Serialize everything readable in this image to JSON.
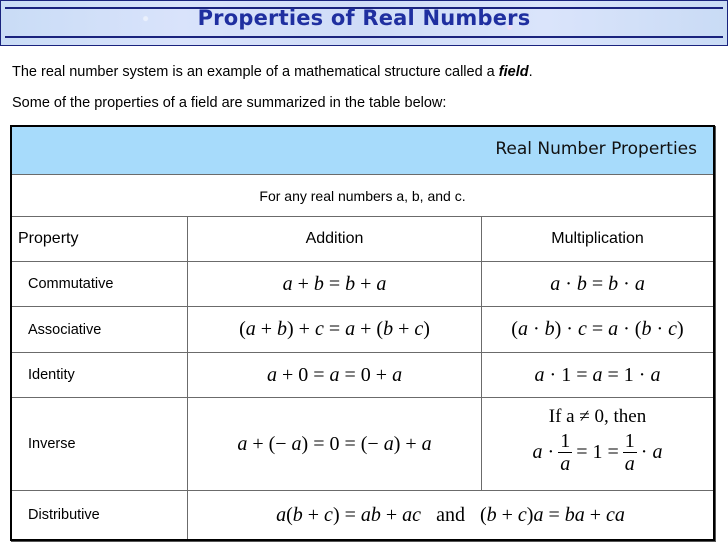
{
  "title": "Properties of Real Numbers",
  "intro": {
    "line1_prefix": "The real number system is an example of a mathematical structure called a ",
    "line1_emphasis": "field",
    "line1_suffix": ".",
    "line2": "Some of the properties of a field are summarized in the table below:"
  },
  "table": {
    "caption": "Real Number Properties",
    "subtitle": "For any real numbers  a,  b,  and  c.",
    "headers": [
      "Property",
      "Addition",
      "Multiplication"
    ],
    "rows": [
      {
        "property": "Commutative",
        "addition": "a + b = b + a",
        "multiplication": "a · b = b · a"
      },
      {
        "property": "Associative",
        "addition": "(a + b) + c = a + (b + c)",
        "multiplication": "(a · b) · c = a · (b · c)"
      },
      {
        "property": "Identity",
        "addition": "a + 0 = a = 0 + a",
        "multiplication": "a · 1 = a = 1 · a"
      },
      {
        "property": "Inverse",
        "addition": "a + (− a) = 0 = (− a) + a",
        "multiplication": {
          "condition": "If a ≠ 0, then",
          "left": "a ·",
          "frac_num": "1",
          "frac_den": "a",
          "middle": "= 1 =",
          "right": "· a"
        }
      },
      {
        "property": "Distributive",
        "combined": "a(b + c) = ab + ac   and   (b + c)a = ba + ca"
      }
    ]
  },
  "colors": {
    "title_text": "#1f2fa0",
    "title_border": "#1a237e",
    "table_header_bg": "#a7dbfb"
  }
}
